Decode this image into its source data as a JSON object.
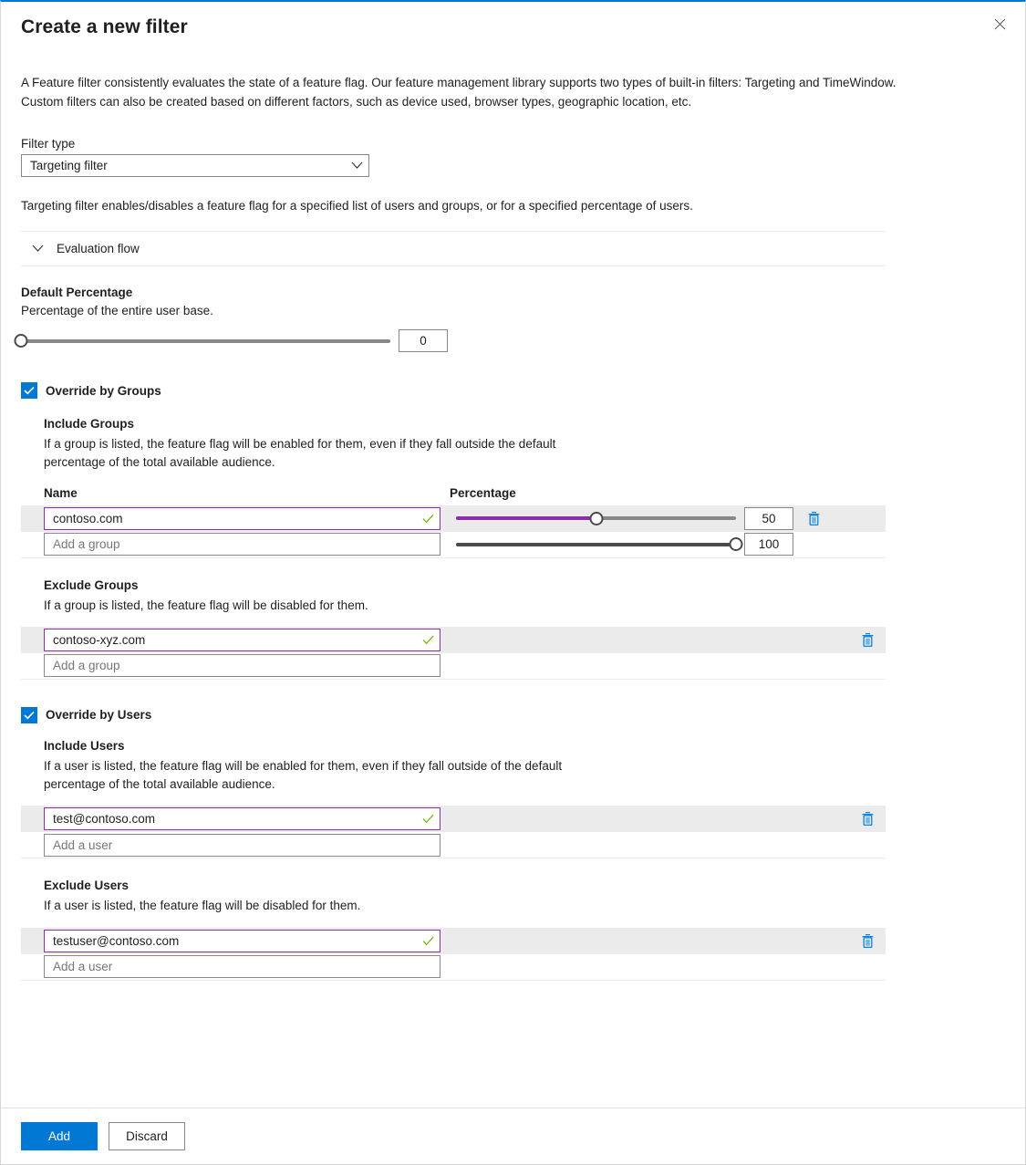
{
  "dialog": {
    "title": "Create a new filter",
    "close_icon": "close-icon",
    "intro": "A Feature filter consistently evaluates the state of a feature flag. Our feature management library supports two types of built-in filters: Targeting and TimeWindow. Custom filters can also be created based on different factors, such as device used, browser types, geographic location, etc."
  },
  "filter_type": {
    "label": "Filter type",
    "value": "Targeting filter",
    "chevron_icon": "chevron-down-icon"
  },
  "targeting_desc": "Targeting filter enables/disables a feature flag for a specified list of users and groups, or for a specified percentage of users.",
  "evaluation_flow": {
    "label": "Evaluation flow",
    "chevron_icon": "chevron-down-icon",
    "expanded": false
  },
  "default_percentage": {
    "title": "Default Percentage",
    "description": "Percentage of the entire user base.",
    "value": "0",
    "slider_percent": 0
  },
  "override_groups": {
    "label": "Override by Groups",
    "checked": true,
    "include": {
      "title": "Include Groups",
      "description": "If a group is listed, the feature flag will be enabled for them, even if they fall outside the default percentage of the total available audience.",
      "columns": {
        "name": "Name",
        "percentage": "Percentage"
      },
      "rows": [
        {
          "name": "contoso.com",
          "percentage": "50",
          "slider_percent": 50,
          "valid": true,
          "filled": true,
          "delete_icon": "trash-icon"
        },
        {
          "name": "",
          "placeholder": "Add a group",
          "percentage": "100",
          "slider_percent": 100,
          "valid": false,
          "filled": false
        }
      ]
    },
    "exclude": {
      "title": "Exclude Groups",
      "description": "If a group is listed, the feature flag will be disabled for them.",
      "rows": [
        {
          "name": "contoso-xyz.com",
          "valid": true,
          "filled": true,
          "delete_icon": "trash-icon"
        },
        {
          "name": "",
          "placeholder": "Add a group",
          "valid": false,
          "filled": false
        }
      ]
    }
  },
  "override_users": {
    "label": "Override by Users",
    "checked": true,
    "include": {
      "title": "Include Users",
      "description": "If a user is listed, the feature flag will be enabled for them, even if they fall outside of the default percentage of the total available audience.",
      "rows": [
        {
          "name": "test@contoso.com",
          "valid": true,
          "filled": true,
          "delete_icon": "trash-icon"
        },
        {
          "name": "",
          "placeholder": "Add a user",
          "valid": false,
          "filled": false
        }
      ]
    },
    "exclude": {
      "title": "Exclude Users",
      "description": "If a user is listed, the feature flag will be disabled for them.",
      "rows": [
        {
          "name": "testuser@contoso.com",
          "valid": true,
          "filled": true,
          "delete_icon": "trash-icon"
        },
        {
          "name": "",
          "placeholder": "Add a user",
          "valid": false,
          "filled": false
        }
      ]
    }
  },
  "footer": {
    "add_label": "Add",
    "discard_label": "Discard"
  },
  "colors": {
    "accent_blue": "#0078d4",
    "slider_purple": "#8e2da8",
    "validation_green": "#6bb700",
    "row_highlight": "#ebebeb",
    "border_grey": "#8a8886"
  }
}
